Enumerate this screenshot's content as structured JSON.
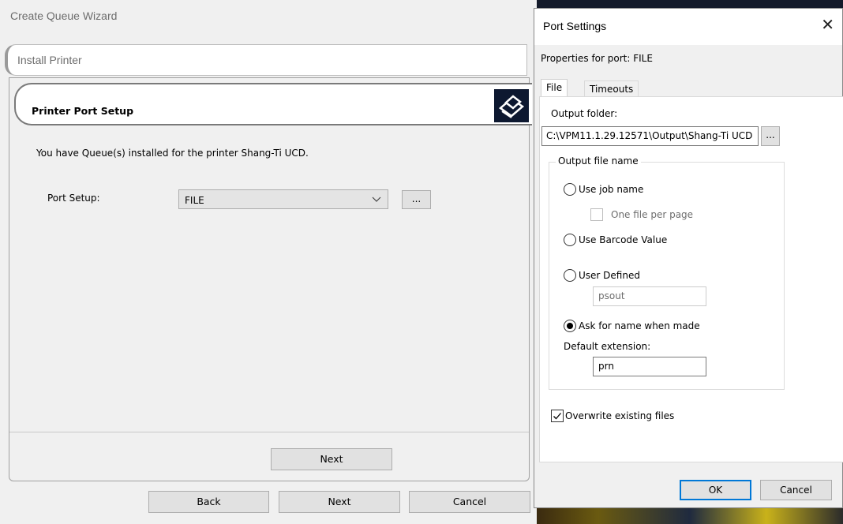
{
  "wizard": {
    "title": "Create Queue Wizard",
    "step_label": "Install Printer",
    "header_title": "Printer Port Setup",
    "info_text": "You have Queue(s) installed for the printer Shang-Ti UCD.",
    "port_setup_label": "Port Setup:",
    "port_setup_value": "FILE",
    "browse_label": "...",
    "inner_next_label": "Next",
    "back_label": "Back",
    "next_label": "Next",
    "cancel_label": "Cancel"
  },
  "dialog": {
    "title": "Port Settings",
    "close_glyph": "✕",
    "properties_label": "Properties for port: FILE",
    "tabs": [
      {
        "label": "File",
        "active": true
      },
      {
        "label": "Timeouts",
        "active": false
      }
    ],
    "output_folder_label": "Output folder:",
    "output_folder_value": "C:\\VPM11.1.29.12571\\Output\\Shang-Ti UCD",
    "browse_label": "...",
    "output_file_group_label": "Output file name",
    "options": {
      "use_job_name": {
        "label": "Use job name",
        "selected": false
      },
      "one_file_per_page": {
        "label": "One file per page",
        "checked": false,
        "enabled": false
      },
      "use_barcode": {
        "label": "Use Barcode Value",
        "selected": false
      },
      "user_defined": {
        "label": "User Defined",
        "selected": false
      },
      "user_defined_value": "psout",
      "ask_for_name": {
        "label": "Ask for name when made",
        "selected": true
      }
    },
    "default_extension_label": "Default extension:",
    "default_extension_value": "prn",
    "overwrite": {
      "label": "Overwrite existing files",
      "checked": true
    },
    "ok_label": "OK",
    "cancel_label": "Cancel"
  }
}
